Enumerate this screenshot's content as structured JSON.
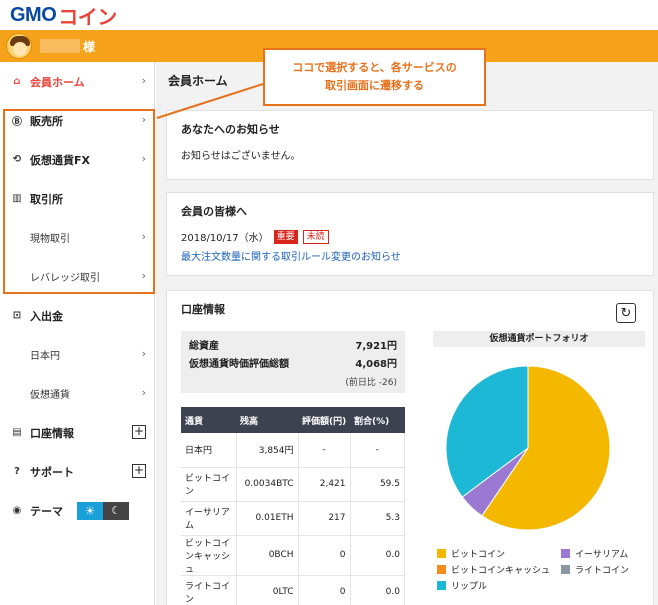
{
  "logo": {
    "gmo": "GMO",
    "coin": "コイン"
  },
  "user": {
    "suffix": "様"
  },
  "sidebar": {
    "items": [
      {
        "label": "会員ホーム",
        "icon": "house-icon"
      },
      {
        "label": "販売所",
        "icon": "bitcoin-icon"
      },
      {
        "label": "仮想通貨FX",
        "icon": "exchange-icon"
      },
      {
        "label": "取引所",
        "icon": "building-icon"
      },
      {
        "label": "現物取引"
      },
      {
        "label": "レバレッジ取引"
      },
      {
        "label": "入出金",
        "icon": "deposit-icon"
      },
      {
        "label": "日本円"
      },
      {
        "label": "仮想通貨"
      },
      {
        "label": "口座情報",
        "icon": "account-icon"
      },
      {
        "label": "サポート",
        "icon": "question-icon"
      },
      {
        "label": "テーマ",
        "icon": "palette-icon"
      }
    ]
  },
  "main": {
    "title": "会員ホーム",
    "notice": {
      "title": "あなたへのお知らせ",
      "text": "お知らせはございません。"
    },
    "members": {
      "title": "会員の皆様へ",
      "date": "2018/10/17（水）",
      "tag_important": "重要",
      "tag_unread": "未読",
      "link": "最大注文数量に関する取引ルール変更のお知らせ"
    },
    "account": {
      "title": "口座情報",
      "total_label": "総資産",
      "total_value": "7,921円",
      "crypto_label": "仮想通貨時価評価総額",
      "crypto_value": "4,068円",
      "change_note": "(前日比 -26)",
      "columns": [
        "通貨",
        "残高",
        "評価額(円)",
        "割合(%)"
      ],
      "rows": [
        [
          "日本円",
          "3,854円",
          "-",
          "-"
        ],
        [
          "ビットコイン",
          "0.0034BTC",
          "2,421",
          "59.5"
        ],
        [
          "イーサリアム",
          "0.01ETH",
          "217",
          "5.3"
        ],
        [
          "ビットコインキャッシュ",
          "0BCH",
          "0",
          "0.0"
        ],
        [
          "ライトコイン",
          "0LTC",
          "0",
          "0.0"
        ]
      ],
      "portfolio_title": "仮想通貨ポートフォリオ"
    }
  },
  "callout": {
    "line1": "ココで選択すると、各サービスの",
    "line2": "取引画面に遷移する"
  },
  "chart_data": {
    "type": "pie",
    "title": "仮想通貨ポートフォリオ",
    "categories": [
      "ビットコイン",
      "イーサリアム",
      "ビットコインキャッシュ",
      "ライトコイン",
      "リップル"
    ],
    "values": [
      59.5,
      5.3,
      0.0,
      0.0,
      35.2
    ],
    "colors": [
      "#f5b800",
      "#9b79d2",
      "#f28c1c",
      "#8a96a3",
      "#1cb8d6"
    ],
    "legend": "bottom"
  },
  "colors": {
    "accent": "#f7a21b",
    "active": "#e8443a",
    "callout": "#e8721c",
    "table_header": "#3c4250"
  }
}
